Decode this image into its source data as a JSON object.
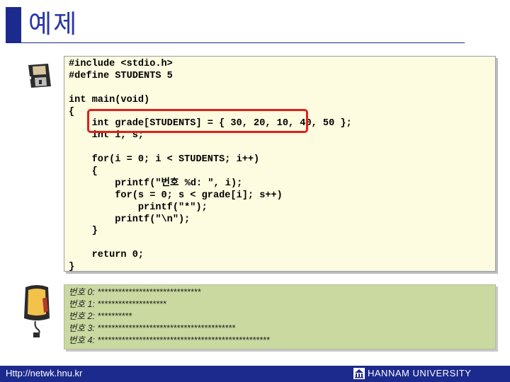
{
  "title": "예제",
  "code": {
    "lines": [
      "#include <stdio.h>",
      "#define STUDENTS 5",
      "",
      "int main(void)",
      "{",
      "    int grade[STUDENTS] = { 30, 20, 10, 40, 50 };",
      "    int i, s;",
      "",
      "    for(i = 0; i < STUDENTS; i++)",
      "    {",
      "        printf(\"번호 %d: \", i);",
      "        for(s = 0; s < grade[i]; s++)",
      "            printf(\"*\");",
      "        printf(\"\\n\");",
      "    }",
      "",
      "    return 0;",
      "}"
    ]
  },
  "output": {
    "lines": [
      "번호 0: ******************************",
      "번호 1: ********************",
      "번호 2: **********",
      "번호 3: ****************************************",
      "번호 4: **************************************************"
    ]
  },
  "footer": {
    "url": "Http://netwk.hnu.kr",
    "university": "HANNAM  UNIVERSITY"
  },
  "icons": {
    "floppy": "floppy-disk-icon",
    "monitor": "monitor-icon",
    "logo": "university-logo-icon"
  },
  "colors": {
    "title": "#2a36a8",
    "accent": "#1b2a8c",
    "code_bg": "#fdfbe0",
    "output_bg": "#c9d9a0",
    "highlight": "#e0201a"
  }
}
